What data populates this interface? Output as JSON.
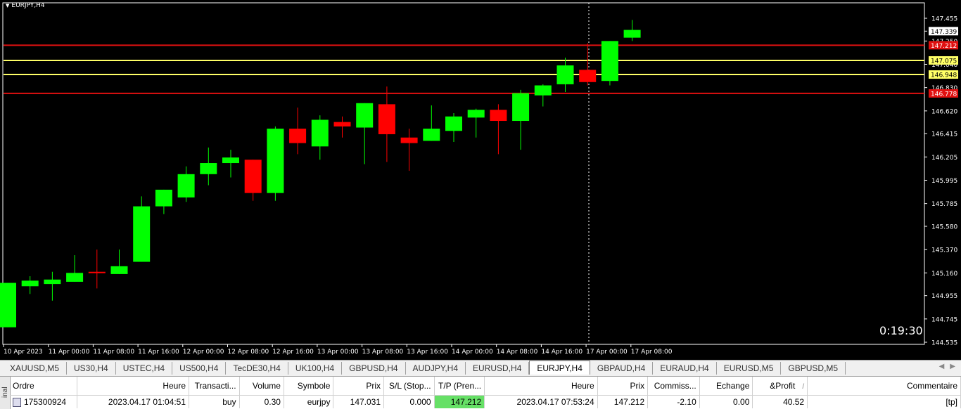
{
  "chart": {
    "title": "EURJPY,H4",
    "countdown": "0:19:30",
    "colors": {
      "background": "#000000",
      "bull": "#00ff00",
      "bear": "#ff0000",
      "grid_text": "#ffffff",
      "support": "#ffff66",
      "resistance": "#e01010"
    },
    "price_axis": [
      "147.455",
      "147.339",
      "147.250",
      "147.040",
      "146.830",
      "146.620",
      "146.415",
      "146.205",
      "145.995",
      "145.785",
      "145.580",
      "145.370",
      "145.160",
      "144.955",
      "144.745",
      "144.535"
    ],
    "time_axis": [
      "10 Apr 2023",
      "11 Apr 00:00",
      "11 Apr 08:00",
      "11 Apr 16:00",
      "12 Apr 00:00",
      "12 Apr 08:00",
      "12 Apr 16:00",
      "13 Apr 00:00",
      "13 Apr 08:00",
      "13 Apr 16:00",
      "14 Apr 00:00",
      "14 Apr 08:00",
      "14 Apr 16:00",
      "17 Apr 00:00",
      "17 Apr 08:00"
    ],
    "ylim": [
      144.535,
      147.455
    ],
    "current_price": {
      "label": "147.339",
      "value": 147.339
    },
    "levels": [
      {
        "label": "147.212",
        "value": 147.212,
        "color": "#e01010",
        "tag_text": "#ffffff"
      },
      {
        "label": "147.075",
        "value": 147.075,
        "color": "#ffff66",
        "tag_text": "#000000"
      },
      {
        "label": "146.948",
        "value": 146.948,
        "color": "#ffff66",
        "tag_text": "#000000"
      },
      {
        "label": "146.778",
        "value": 146.778,
        "color": "#e01010",
        "tag_text": "#ffffff"
      }
    ],
    "candles": [
      {
        "o": 144.67,
        "h": 145.07,
        "l": 144.67,
        "c": 145.07
      },
      {
        "o": 145.04,
        "h": 145.13,
        "l": 144.97,
        "c": 145.09
      },
      {
        "o": 145.06,
        "h": 145.17,
        "l": 144.91,
        "c": 145.1
      },
      {
        "o": 145.08,
        "h": 145.32,
        "l": 145.08,
        "c": 145.16
      },
      {
        "o": 145.17,
        "h": 145.37,
        "l": 145.02,
        "c": 145.16
      },
      {
        "o": 145.15,
        "h": 145.37,
        "l": 145.15,
        "c": 145.22
      },
      {
        "o": 145.26,
        "h": 145.85,
        "l": 145.26,
        "c": 145.76
      },
      {
        "o": 145.76,
        "h": 145.91,
        "l": 145.69,
        "c": 145.91
      },
      {
        "o": 145.84,
        "h": 146.12,
        "l": 145.8,
        "c": 146.05
      },
      {
        "o": 146.05,
        "h": 146.29,
        "l": 145.95,
        "c": 146.15
      },
      {
        "o": 146.15,
        "h": 146.27,
        "l": 146.02,
        "c": 146.2
      },
      {
        "o": 146.18,
        "h": 146.15,
        "l": 145.81,
        "c": 145.88
      },
      {
        "o": 145.88,
        "h": 146.48,
        "l": 145.81,
        "c": 146.46
      },
      {
        "o": 146.46,
        "h": 146.65,
        "l": 146.23,
        "c": 146.33
      },
      {
        "o": 146.3,
        "h": 146.58,
        "l": 146.18,
        "c": 146.54
      },
      {
        "o": 146.52,
        "h": 146.57,
        "l": 146.38,
        "c": 146.48
      },
      {
        "o": 146.47,
        "h": 146.69,
        "l": 146.14,
        "c": 146.69
      },
      {
        "o": 146.68,
        "h": 146.84,
        "l": 146.16,
        "c": 146.41
      },
      {
        "o": 146.38,
        "h": 146.46,
        "l": 146.08,
        "c": 146.33
      },
      {
        "o": 146.35,
        "h": 146.67,
        "l": 146.35,
        "c": 146.46
      },
      {
        "o": 146.44,
        "h": 146.6,
        "l": 146.34,
        "c": 146.57
      },
      {
        "o": 146.56,
        "h": 146.64,
        "l": 146.38,
        "c": 146.63
      },
      {
        "o": 146.63,
        "h": 146.68,
        "l": 146.23,
        "c": 146.53
      },
      {
        "o": 146.53,
        "h": 146.81,
        "l": 146.27,
        "c": 146.78
      },
      {
        "o": 146.76,
        "h": 146.86,
        "l": 146.66,
        "c": 146.85
      },
      {
        "o": 146.86,
        "h": 147.1,
        "l": 146.79,
        "c": 147.03
      },
      {
        "o": 146.99,
        "h": 147.23,
        "l": 146.85,
        "c": 146.88
      },
      {
        "o": 146.89,
        "h": 147.25,
        "l": 146.85,
        "c": 147.25
      },
      {
        "o": 147.28,
        "h": 147.44,
        "l": 147.25,
        "c": 147.35
      }
    ]
  },
  "tabs": [
    "XAUUSD,M5",
    "US30,H4",
    "USTEC,H4",
    "US500,H4",
    "TecDE30,H4",
    "UK100,H4",
    "GBPUSD,H4",
    "AUDJPY,H4",
    "EURUSD,H4",
    "EURJPY,H4",
    "GBPAUD,H4",
    "EURAUD,H4",
    "EURUSD,M5",
    "GBPUSD,M5"
  ],
  "active_tab": "EURJPY,H4",
  "terminal": {
    "side_label": "inal",
    "headers": {
      "ordre": "Ordre",
      "heure": "Heure",
      "transaction": "Transacti...",
      "volume": "Volume",
      "symbole": "Symbole",
      "prix": "Prix",
      "sl": "S/L (Stop...",
      "tp": "T/P (Pren...",
      "heure2": "Heure",
      "prix2": "Prix",
      "commission": "Commiss...",
      "echange": "Echange",
      "profit": "&Profit",
      "sort": "/",
      "commentaire": "Commentaire"
    },
    "row": {
      "ordre": "175300924",
      "heure": "2023.04.17 01:04:51",
      "transaction": "buy",
      "volume": "0.30",
      "symbole": "eurjpy",
      "prix": "147.031",
      "sl": "0.000",
      "tp": "147.212",
      "heure2": "2023.04.17 07:53:24",
      "prix2": "147.212",
      "commission": "-2.10",
      "echange": "0.00",
      "profit": "40.52",
      "commentaire": "[tp]"
    }
  }
}
